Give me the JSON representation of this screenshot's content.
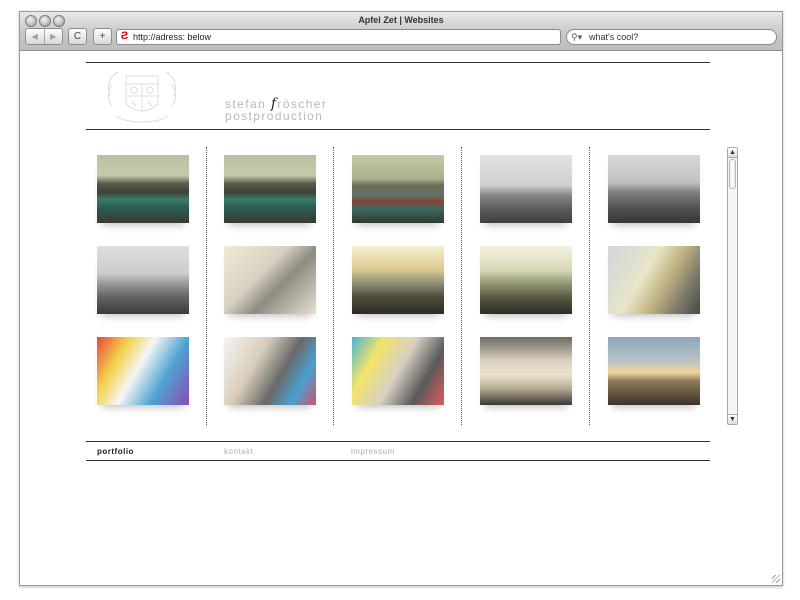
{
  "browser": {
    "title": "Apfel Zet | Websites",
    "back_label": "◀",
    "forward_label": "▶",
    "reload_label": "C",
    "add_label": "+",
    "address": "http://adress: below",
    "search_placeholder": "what's cool?"
  },
  "site": {
    "brand_line1_part1": "stefan ",
    "brand_line1_accent": "f",
    "brand_line1_part2": "röscher",
    "brand_line2": "postproduction"
  },
  "thumbnails": [
    {
      "name": "thumb-mountain-lake-1",
      "scene": "mountain-lake"
    },
    {
      "name": "thumb-mountain-lake-2",
      "scene": "mountain-lake"
    },
    {
      "name": "thumb-lake-boat",
      "scene": "lake-boat"
    },
    {
      "name": "thumb-foggy-sea-1",
      "scene": "foggy-sea"
    },
    {
      "name": "thumb-foggy-sea-2",
      "scene": "foggy-sea-dark"
    },
    {
      "name": "thumb-foggy-lake-trees",
      "scene": "foggy-trees"
    },
    {
      "name": "thumb-cars-topview",
      "scene": "cars-top"
    },
    {
      "name": "thumb-car-city-sunset",
      "scene": "car-city"
    },
    {
      "name": "thumb-car-road",
      "scene": "car-road"
    },
    {
      "name": "thumb-car-building",
      "scene": "car-building"
    },
    {
      "name": "thumb-car-paint-splash",
      "scene": "car-splash"
    },
    {
      "name": "thumb-car-rear-splash",
      "scene": "car-rear"
    },
    {
      "name": "thumb-car-front-colors",
      "scene": "car-front"
    },
    {
      "name": "thumb-car-interior",
      "scene": "interior"
    },
    {
      "name": "thumb-sunset-landscape",
      "scene": "sunset"
    }
  ],
  "footer": {
    "portfolio": "portfolio",
    "kontakt": "kontakt",
    "impressum": "impressum"
  },
  "colors": {
    "footer_active": "#222222",
    "footer_inactive": "#b0b0b0"
  }
}
